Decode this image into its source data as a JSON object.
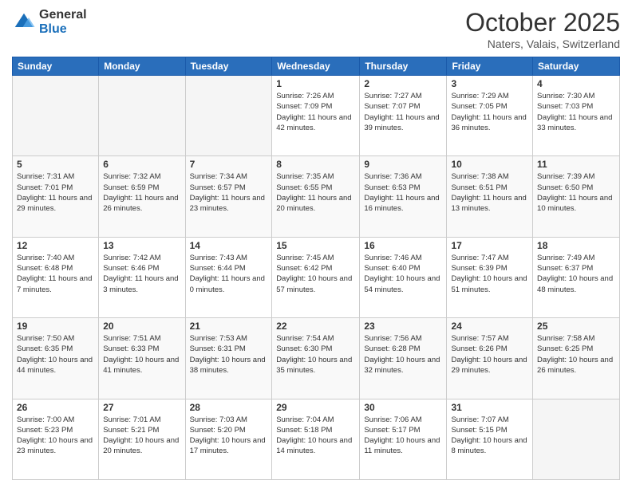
{
  "logo": {
    "general": "General",
    "blue": "Blue"
  },
  "header": {
    "month": "October 2025",
    "location": "Naters, Valais, Switzerland"
  },
  "weekdays": [
    "Sunday",
    "Monday",
    "Tuesday",
    "Wednesday",
    "Thursday",
    "Friday",
    "Saturday"
  ],
  "weeks": [
    [
      {
        "day": "",
        "sunrise": "",
        "sunset": "",
        "daylight": "",
        "empty": true
      },
      {
        "day": "",
        "sunrise": "",
        "sunset": "",
        "daylight": "",
        "empty": true
      },
      {
        "day": "",
        "sunrise": "",
        "sunset": "",
        "daylight": "",
        "empty": true
      },
      {
        "day": "1",
        "sunrise": "7:26 AM",
        "sunset": "7:09 PM",
        "daylight": "11 hours and 42 minutes."
      },
      {
        "day": "2",
        "sunrise": "7:27 AM",
        "sunset": "7:07 PM",
        "daylight": "11 hours and 39 minutes."
      },
      {
        "day": "3",
        "sunrise": "7:29 AM",
        "sunset": "7:05 PM",
        "daylight": "11 hours and 36 minutes."
      },
      {
        "day": "4",
        "sunrise": "7:30 AM",
        "sunset": "7:03 PM",
        "daylight": "11 hours and 33 minutes."
      }
    ],
    [
      {
        "day": "5",
        "sunrise": "7:31 AM",
        "sunset": "7:01 PM",
        "daylight": "11 hours and 29 minutes."
      },
      {
        "day": "6",
        "sunrise": "7:32 AM",
        "sunset": "6:59 PM",
        "daylight": "11 hours and 26 minutes."
      },
      {
        "day": "7",
        "sunrise": "7:34 AM",
        "sunset": "6:57 PM",
        "daylight": "11 hours and 23 minutes."
      },
      {
        "day": "8",
        "sunrise": "7:35 AM",
        "sunset": "6:55 PM",
        "daylight": "11 hours and 20 minutes."
      },
      {
        "day": "9",
        "sunrise": "7:36 AM",
        "sunset": "6:53 PM",
        "daylight": "11 hours and 16 minutes."
      },
      {
        "day": "10",
        "sunrise": "7:38 AM",
        "sunset": "6:51 PM",
        "daylight": "11 hours and 13 minutes."
      },
      {
        "day": "11",
        "sunrise": "7:39 AM",
        "sunset": "6:50 PM",
        "daylight": "11 hours and 10 minutes."
      }
    ],
    [
      {
        "day": "12",
        "sunrise": "7:40 AM",
        "sunset": "6:48 PM",
        "daylight": "11 hours and 7 minutes."
      },
      {
        "day": "13",
        "sunrise": "7:42 AM",
        "sunset": "6:46 PM",
        "daylight": "11 hours and 3 minutes."
      },
      {
        "day": "14",
        "sunrise": "7:43 AM",
        "sunset": "6:44 PM",
        "daylight": "11 hours and 0 minutes."
      },
      {
        "day": "15",
        "sunrise": "7:45 AM",
        "sunset": "6:42 PM",
        "daylight": "10 hours and 57 minutes."
      },
      {
        "day": "16",
        "sunrise": "7:46 AM",
        "sunset": "6:40 PM",
        "daylight": "10 hours and 54 minutes."
      },
      {
        "day": "17",
        "sunrise": "7:47 AM",
        "sunset": "6:39 PM",
        "daylight": "10 hours and 51 minutes."
      },
      {
        "day": "18",
        "sunrise": "7:49 AM",
        "sunset": "6:37 PM",
        "daylight": "10 hours and 48 minutes."
      }
    ],
    [
      {
        "day": "19",
        "sunrise": "7:50 AM",
        "sunset": "6:35 PM",
        "daylight": "10 hours and 44 minutes."
      },
      {
        "day": "20",
        "sunrise": "7:51 AM",
        "sunset": "6:33 PM",
        "daylight": "10 hours and 41 minutes."
      },
      {
        "day": "21",
        "sunrise": "7:53 AM",
        "sunset": "6:31 PM",
        "daylight": "10 hours and 38 minutes."
      },
      {
        "day": "22",
        "sunrise": "7:54 AM",
        "sunset": "6:30 PM",
        "daylight": "10 hours and 35 minutes."
      },
      {
        "day": "23",
        "sunrise": "7:56 AM",
        "sunset": "6:28 PM",
        "daylight": "10 hours and 32 minutes."
      },
      {
        "day": "24",
        "sunrise": "7:57 AM",
        "sunset": "6:26 PM",
        "daylight": "10 hours and 29 minutes."
      },
      {
        "day": "25",
        "sunrise": "7:58 AM",
        "sunset": "6:25 PM",
        "daylight": "10 hours and 26 minutes."
      }
    ],
    [
      {
        "day": "26",
        "sunrise": "7:00 AM",
        "sunset": "5:23 PM",
        "daylight": "10 hours and 23 minutes."
      },
      {
        "day": "27",
        "sunrise": "7:01 AM",
        "sunset": "5:21 PM",
        "daylight": "10 hours and 20 minutes."
      },
      {
        "day": "28",
        "sunrise": "7:03 AM",
        "sunset": "5:20 PM",
        "daylight": "10 hours and 17 minutes."
      },
      {
        "day": "29",
        "sunrise": "7:04 AM",
        "sunset": "5:18 PM",
        "daylight": "10 hours and 14 minutes."
      },
      {
        "day": "30",
        "sunrise": "7:06 AM",
        "sunset": "5:17 PM",
        "daylight": "10 hours and 11 minutes."
      },
      {
        "day": "31",
        "sunrise": "7:07 AM",
        "sunset": "5:15 PM",
        "daylight": "10 hours and 8 minutes."
      },
      {
        "day": "",
        "sunrise": "",
        "sunset": "",
        "daylight": "",
        "empty": true
      }
    ]
  ]
}
